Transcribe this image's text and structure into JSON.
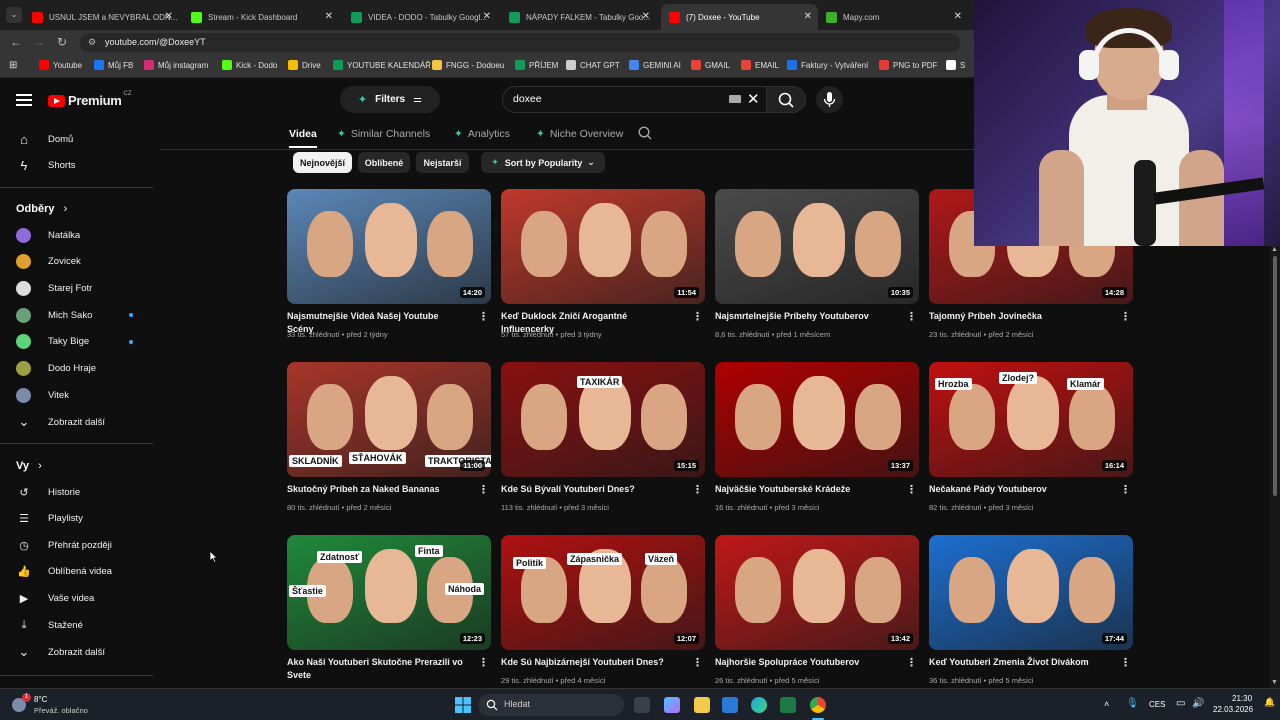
{
  "browser": {
    "tabs": [
      {
        "title": "USNUL JSEM a NEVYBRAL ODN...",
        "icon": "youtube-icon",
        "color": "#ff0000"
      },
      {
        "title": "Stream - Kick Dashboard",
        "icon": "kick-icon",
        "color": "#53fc18"
      },
      {
        "title": "VIDEA - DODO - Tabulky Googl...",
        "icon": "sheets-icon",
        "color": "#0f9d58"
      },
      {
        "title": "NÁPADY FALKEM - Tabulky Goo...",
        "icon": "sheets-icon",
        "color": "#0f9d58"
      },
      {
        "title": "(7) Doxee - YouTube",
        "icon": "youtube-icon",
        "color": "#ff0000"
      },
      {
        "title": "Mapy.com",
        "icon": "mapy-icon",
        "color": "#3fae2a"
      }
    ],
    "url": "youtube.com/@DoxeeYT",
    "bookmarks": [
      {
        "label": "Youtube",
        "color": "#ff0000"
      },
      {
        "label": "Můj FB",
        "color": "#1877f2"
      },
      {
        "label": "Můj instagram",
        "color": "#d62976"
      },
      {
        "label": "Kick - Dodo",
        "color": "#53fc18"
      },
      {
        "label": "Drive",
        "color": "#fbbc04"
      },
      {
        "label": "YOUTUBE KALENDÁŘ",
        "color": "#0f9d58"
      },
      {
        "label": "FNGG - Dodoeu",
        "color": "#f5c542"
      },
      {
        "label": "PŘÍJEM",
        "color": "#0f9d58"
      },
      {
        "label": "CHAT GPT",
        "color": "#cccccc"
      },
      {
        "label": "GEMINI AI",
        "color": "#4285f4"
      },
      {
        "label": "GMAIL",
        "color": "#ea4335"
      },
      {
        "label": "EMAIL",
        "color": "#ea4335"
      },
      {
        "label": "Faktury - Vytváření",
        "color": "#1a73e8"
      },
      {
        "label": "PNG to PDF",
        "color": "#e53935"
      },
      {
        "label": "S",
        "color": "#ffffff"
      }
    ]
  },
  "yt": {
    "logo_text": "Premium",
    "logo_region": "CZ",
    "filters_label": "Filters",
    "search_value": "doxee",
    "sidebar": {
      "main": [
        {
          "label": "Domů",
          "icon": "home-icon"
        },
        {
          "label": "Shorts",
          "icon": "shorts-icon"
        }
      ],
      "subs_heading": "Odběry",
      "subs": [
        {
          "label": "Natálka",
          "color": "#8e6bd8",
          "dot": false
        },
        {
          "label": "Zovicek",
          "color": "#e0a030",
          "dot": false
        },
        {
          "label": "Starej Fotr",
          "color": "#dddddd",
          "dot": false
        },
        {
          "label": "Mich Sako",
          "color": "#6aa07a",
          "dot": true
        },
        {
          "label": "Taky Bige",
          "color": "#5fd37a",
          "dot": true
        },
        {
          "label": "Dodo Hraje",
          "color": "#9aa040",
          "dot": false
        },
        {
          "label": "Vitek",
          "color": "#7a8aa8",
          "dot": false
        }
      ],
      "subs_more": "Zobrazit další",
      "you_heading": "Vy",
      "you": [
        {
          "label": "Historie",
          "icon": "history-icon"
        },
        {
          "label": "Playlisty",
          "icon": "playlist-icon"
        },
        {
          "label": "Přehrát později",
          "icon": "clock-icon"
        },
        {
          "label": "Oblíbená videa",
          "icon": "thumbs-up-icon"
        },
        {
          "label": "Vaše videa",
          "icon": "video-icon"
        },
        {
          "label": "Stažené",
          "icon": "download-icon"
        }
      ],
      "you_more": "Zobrazit další"
    },
    "channel_tabs": [
      "Videa",
      "Similar Channels",
      "Analytics",
      "Niche Overview"
    ],
    "chips": [
      "Nejnovější",
      "Oblíbené",
      "Nejstarší"
    ],
    "sort_label": "Sort by Popularity",
    "videos": [
      {
        "title": "Najsmutnejšie Videá Našej Youtube Scény",
        "views": "33 tis. zhlédnutí",
        "age": "před 2 týdny",
        "duration": "14:20",
        "bg": "#5b88b8"
      },
      {
        "title": "Keď Duklock Zničí Arogantné Influencerky",
        "views": "57 tis. zhlédnutí",
        "age": "před 3 týdny",
        "duration": "11:54",
        "bg": "#c0392b"
      },
      {
        "title": "Najsmrtelnejšie Príbehy Youtuberov",
        "views": "8,6 tis. zhlédnutí",
        "age": "před 1 měsícem",
        "duration": "10:35",
        "bg": "#4a4a4a"
      },
      {
        "title": "Tajomný Príbeh Jovinečka",
        "views": "23 tis. zhlédnutí",
        "age": "před 2 měsíci",
        "duration": "14:28",
        "bg": "#b01818"
      },
      {
        "title": "Skutočný Príbeh za Naked Bananas",
        "views": "80 tis. zhlédnutí",
        "age": "před 2 měsíci",
        "duration": "11:00",
        "bg": "#a8352a",
        "labels": [
          "SKLADNÍK",
          "SŤAHOVÁK",
          "TRAKTORISTA"
        ]
      },
      {
        "title": "Kde Sú Bývalí Youtuberi Dnes?",
        "views": "113 tis. zhlédnutí",
        "age": "před 3 měsíci",
        "duration": "15:15",
        "bg": "#8a1010",
        "labels": [
          "TAXIKÁR"
        ]
      },
      {
        "title": "Najväčšie Youtuberské Krádeže",
        "views": "16 tis. zhlédnutí",
        "age": "před 3 měsíci",
        "duration": "13:37",
        "bg": "#b00000"
      },
      {
        "title": "Nečakané Pády Youtuberov",
        "views": "82 tis. zhlédnutí",
        "age": "před 3 měsíci",
        "duration": "16:14",
        "bg": "#c01010",
        "labels": [
          "Hrozba",
          "Zlodej?",
          "Klamár"
        ]
      },
      {
        "title": "Ako Naši Youtuberi Skutočne Prerazili vo Svete",
        "views": "",
        "age": "",
        "duration": "12:23",
        "bg": "#1f8a3a",
        "labels": [
          "Zdatnosť",
          "Finta",
          "Šťastie",
          "Náhoda"
        ]
      },
      {
        "title": "Kde Sú Najbizárnejší Youtuberi Dnes?",
        "views": "29 tis. zhlédnutí",
        "age": "před 4 měsíci",
        "duration": "12:07",
        "bg": "#b01010",
        "labels": [
          "Politik",
          "Zápasnička",
          "Väzeň"
        ]
      },
      {
        "title": "Najhoršie Spolupráce Youtuberov",
        "views": "26 tis. zhlédnutí",
        "age": "před 5 měsíci",
        "duration": "13:42",
        "bg": "#c01818"
      },
      {
        "title": "Keď Youtuberi Zmenia Život Divákom",
        "views": "36 tis. zhlédnutí",
        "age": "před 5 měsíci",
        "duration": "17:44",
        "bg": "#1c6fd0"
      }
    ]
  },
  "taskbar": {
    "weather_temp": "8°C",
    "weather_desc": "Převáž. oblačno",
    "search_placeholder": "Hledat",
    "lang": "CES",
    "time": "21:30",
    "date": "22.03.2026",
    "badge": "1"
  }
}
